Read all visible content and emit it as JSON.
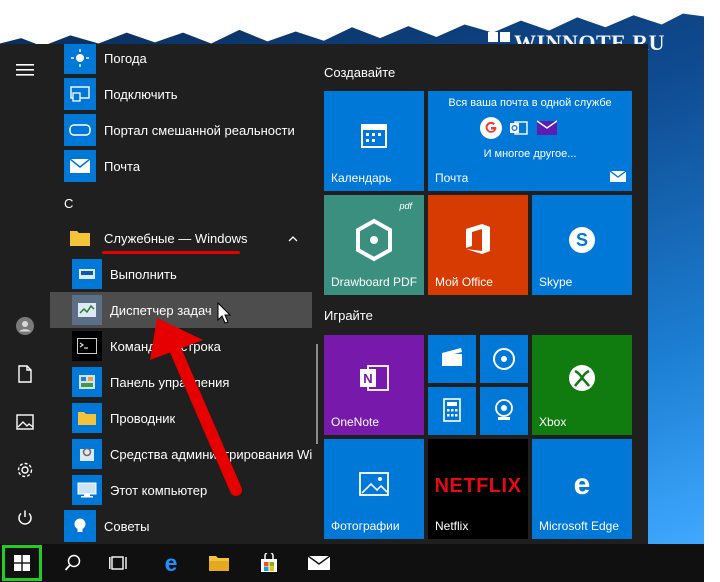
{
  "watermark": {
    "text": "WINNOTE.RU"
  },
  "colors": {
    "accent": "#0078d7",
    "menu_bg": "#1f1f1f",
    "hover": "#4d4d4d",
    "annotation": "#e60000",
    "highlight": "#22cc22"
  },
  "rail": {
    "items": [
      {
        "name": "hamburger-icon"
      },
      {
        "name": "user-icon"
      },
      {
        "name": "documents-icon"
      },
      {
        "name": "pictures-icon"
      },
      {
        "name": "settings-icon"
      },
      {
        "name": "power-icon"
      }
    ]
  },
  "apps": {
    "weather": "Погода",
    "connect": "Подключить",
    "mixed_reality": "Портал смешанной реальности",
    "mail": "Почта",
    "letter_c": "С",
    "folder": "Служебные — Windows",
    "run": "Выполнить",
    "task_manager": "Диспетчер задач",
    "cmd": "Командная строка",
    "control_panel": "Панель управления",
    "explorer": "Проводник",
    "admin_tools": "Средства администрирования Wi...",
    "this_pc": "Этот компьютер",
    "tips": "Советы"
  },
  "tiles": {
    "group_create": "Создавайте",
    "group_play": "Играйте",
    "calendar": "Календарь",
    "mail_title": "Вся ваша почта в одной службе",
    "mail_more": "И многое другое...",
    "mail": "Почта",
    "drawboard": "Drawboard PDF",
    "office": "Мой Office",
    "skype": "Skype",
    "onenote": "OneNote",
    "xbox": "Xbox",
    "photos": "Фотографии",
    "netflix": "Netflix",
    "netflix_logo": "NETFLIX",
    "edge": "Microsoft Edge"
  },
  "taskbar": {
    "items": [
      {
        "name": "start-button"
      },
      {
        "name": "search-icon"
      },
      {
        "name": "task-view-icon"
      },
      {
        "name": "edge-icon"
      },
      {
        "name": "file-explorer-icon"
      },
      {
        "name": "store-icon"
      },
      {
        "name": "mail-icon"
      }
    ]
  }
}
